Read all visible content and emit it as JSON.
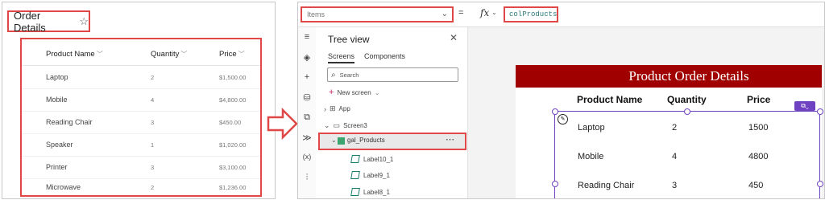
{
  "sharepoint_list": {
    "title": "Order Details",
    "star_glyph": "☆",
    "columns": {
      "product_name": "Product Name",
      "quantity": "Quantity",
      "price": "Price"
    },
    "rows": [
      {
        "name": "Laptop",
        "quantity": "2",
        "price": "$1,500.00"
      },
      {
        "name": "Mobile",
        "quantity": "4",
        "price": "$4,800.00"
      },
      {
        "name": "Reading Chair",
        "quantity": "3",
        "price": "$450.00"
      },
      {
        "name": "Speaker",
        "quantity": "1",
        "price": "$1,020.00"
      },
      {
        "name": "Printer",
        "quantity": "3",
        "price": "$3,100.00"
      },
      {
        "name": "Microwave",
        "quantity": "2",
        "price": "$1,236.00"
      }
    ]
  },
  "power_apps": {
    "formula_bar": {
      "property": "Items",
      "equals": "=",
      "fx": "fx",
      "formula": "colProducts"
    },
    "tree_view": {
      "title": "Tree view",
      "tabs": [
        "Screens",
        "Components"
      ],
      "search_placeholder": "Search",
      "new_screen": "New screen",
      "items": {
        "app": "App",
        "screen": "Screen3",
        "gallery": "gal_Products",
        "labels": [
          "Label10_1",
          "Label9_1",
          "Label8_1"
        ]
      }
    },
    "canvas": {
      "header": "Product Order Details",
      "columns": {
        "product_name": "Product Name",
        "quantity": "Quantity",
        "price": "Price"
      },
      "rows": [
        {
          "name": "Laptop",
          "quantity": "2",
          "price": "1500"
        },
        {
          "name": "Mobile",
          "quantity": "4",
          "price": "4800"
        },
        {
          "name": "Reading Chair",
          "quantity": "3",
          "price": "450"
        }
      ]
    }
  },
  "colors": {
    "highlight": "#e04848",
    "header_red": "#a00000",
    "selection_purple": "#6f42c1"
  }
}
